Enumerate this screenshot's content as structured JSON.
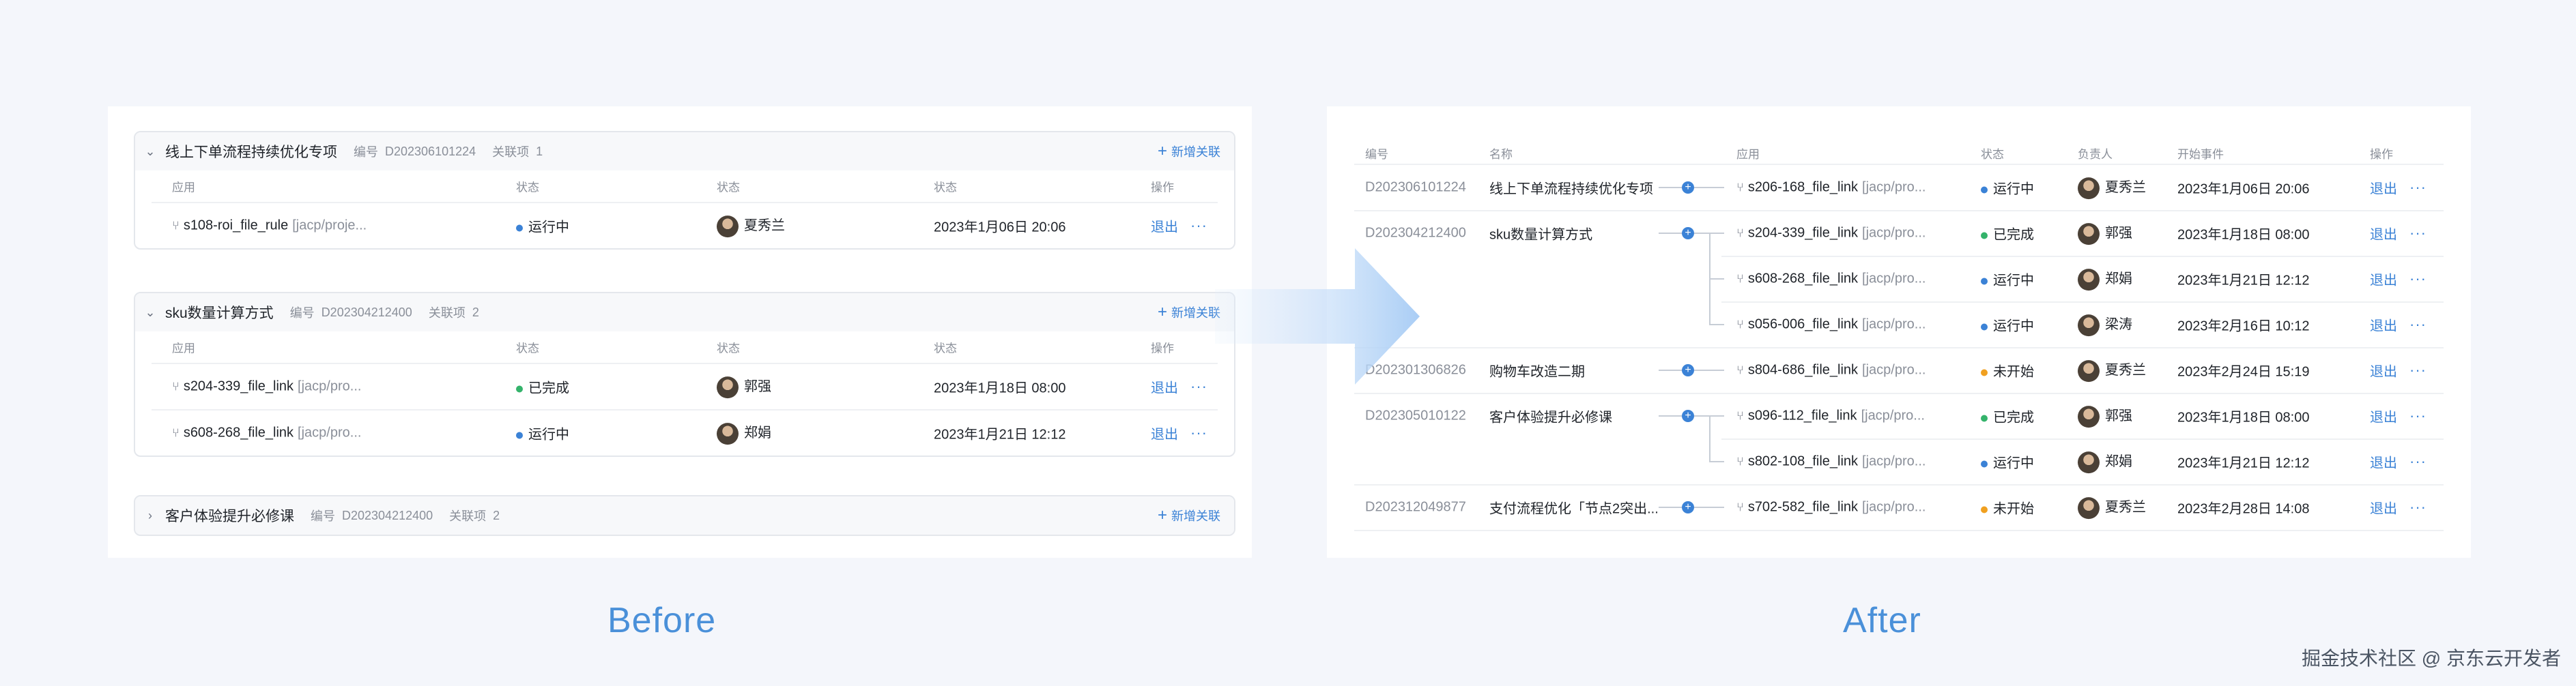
{
  "before": {
    "groups": [
      {
        "expanded": true,
        "name": "线上下单流程持续优化专项",
        "code_label": "编号",
        "code": "D202306101224",
        "rel_label": "关联项",
        "rel_count": "1",
        "add_label": "新增关联",
        "columns": [
          "应用",
          "状态",
          "状态",
          "状态",
          "操作"
        ],
        "rows": [
          {
            "app": "s108-roi_file_rule",
            "path": "[jacp/proje...",
            "status": "运行中",
            "status_color": "#3b82d6",
            "owner": "夏秀兰",
            "time": "2023年1月06日 20:06",
            "action": "退出",
            "more": "···"
          }
        ]
      },
      {
        "expanded": true,
        "name": "sku数量计算方式",
        "code_label": "编号",
        "code": "D202304212400",
        "rel_label": "关联项",
        "rel_count": "2",
        "add_label": "新增关联",
        "columns": [
          "应用",
          "状态",
          "状态",
          "状态",
          "操作"
        ],
        "rows": [
          {
            "app": "s204-339_file_link",
            "path": "[jacp/pro...",
            "status": "已完成",
            "status_color": "#34b36b",
            "owner": "郭强",
            "time": "2023年1月18日 08:00",
            "action": "退出",
            "more": "···"
          },
          {
            "app": "s608-268_file_link",
            "path": "[jacp/pro...",
            "status": "运行中",
            "status_color": "#3b82d6",
            "owner": "郑娟",
            "time": "2023年1月21日 12:12",
            "action": "退出",
            "more": "···"
          }
        ]
      },
      {
        "expanded": false,
        "name": "客户体验提升必修课",
        "code_label": "编号",
        "code": "D202304212400",
        "rel_label": "关联项",
        "rel_count": "2",
        "add_label": "新增关联"
      }
    ]
  },
  "after": {
    "columns": [
      "编号",
      "名称",
      "应用",
      "状态",
      "负责人",
      "开始事件",
      "操作"
    ],
    "groups": [
      {
        "code": "D202306101224",
        "name": "线上下单流程持续优化专项",
        "apps": [
          {
            "app": "s206-168_file_link",
            "path": "[jacp/pro...",
            "status": "运行中",
            "status_color": "#3b82d6",
            "owner": "夏秀兰",
            "time": "2023年1月06日 20:06"
          }
        ]
      },
      {
        "code": "D202304212400",
        "name": "sku数量计算方式",
        "apps": [
          {
            "app": "s204-339_file_link",
            "path": "[jacp/pro...",
            "status": "已完成",
            "status_color": "#34b36b",
            "owner": "郭强",
            "time": "2023年1月18日 08:00"
          },
          {
            "app": "s608-268_file_link",
            "path": "[jacp/pro...",
            "status": "运行中",
            "status_color": "#3b82d6",
            "owner": "郑娟",
            "time": "2023年1月21日 12:12"
          },
          {
            "app": "s056-006_file_link",
            "path": "[jacp/pro...",
            "status": "运行中",
            "status_color": "#3b82d6",
            "owner": "梁涛",
            "time": "2023年2月16日 10:12"
          }
        ]
      },
      {
        "code": "D202301306826",
        "name": "购物车改造二期",
        "apps": [
          {
            "app": "s804-686_file_link",
            "path": "[jacp/pro...",
            "status": "未开始",
            "status_color": "#f0a020",
            "owner": "夏秀兰",
            "time": "2023年2月24日 15:19"
          }
        ]
      },
      {
        "code": "D202305010122",
        "name": "客户体验提升必修课",
        "apps": [
          {
            "app": "s096-112_file_link",
            "path": "[jacp/pro...",
            "status": "已完成",
            "status_color": "#34b36b",
            "owner": "郭强",
            "time": "2023年1月18日 08:00"
          },
          {
            "app": "s802-108_file_link",
            "path": "[jacp/pro...",
            "status": "运行中",
            "status_color": "#3b82d6",
            "owner": "郑娟",
            "time": "2023年1月21日 12:12"
          }
        ]
      },
      {
        "code": "D202312049877",
        "name": "支付流程优化「节点2突出...",
        "apps": [
          {
            "app": "s702-582_file_link",
            "path": "[jacp/pro...",
            "status": "未开始",
            "status_color": "#f0a020",
            "owner": "夏秀兰",
            "time": "2023年2月28日 14:08"
          }
        ]
      }
    ],
    "action": "退出",
    "more": "···"
  },
  "captions": {
    "before": "Before",
    "after": "After"
  },
  "watermark": "掘金技术社区 @ 京东云开发者",
  "icons": {
    "expand": "chevron-down-icon",
    "collapse": "chevron-right-icon",
    "app": "branch-icon",
    "add": "plus-icon",
    "node": "plus-node-icon"
  },
  "colors": {
    "accent": "#3b82d6",
    "running": "#3b82d6",
    "done": "#34b36b",
    "pending": "#f0a020",
    "caption": "#4a90d9"
  }
}
